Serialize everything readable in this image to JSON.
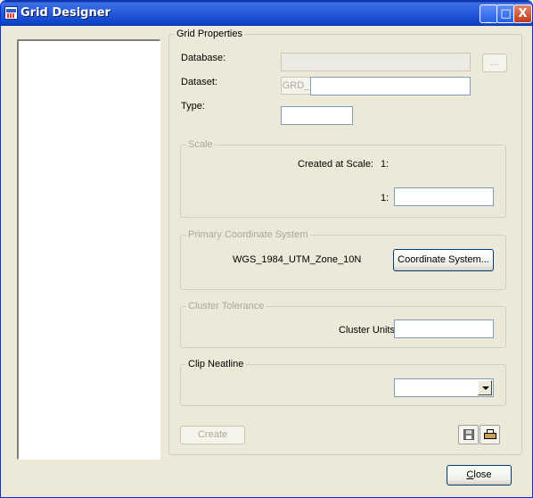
{
  "window": {
    "title": "Grid Designer",
    "minimize_glyph": "_",
    "maximize_glyph": "□",
    "close_glyph": "X"
  },
  "grid_properties": {
    "legend": "Grid Properties",
    "database_label": "Database:",
    "database_value": "",
    "browse_button": "...",
    "dataset_label": "Dataset:",
    "dataset_prefix": "GRD_",
    "dataset_value": "",
    "type_label": "Type:",
    "type_value": ""
  },
  "scale": {
    "legend": "Scale",
    "created_at_scale_label": "Created at Scale:",
    "created_at_scale_value": "1:",
    "scale_prefix": "1:",
    "scale_value": ""
  },
  "coordinate_system": {
    "legend": "Primary Coordinate System",
    "name": "WGS_1984_UTM_Zone_10N",
    "button": "Coordinate System..."
  },
  "cluster_tolerance": {
    "legend": "Cluster Tolerance",
    "units_label": "Cluster Units",
    "value": ""
  },
  "clip_neatline": {
    "legend": "Clip Neatline",
    "selected": ""
  },
  "actions": {
    "create_button": "Create",
    "close_button_prefix": "",
    "close_button_mnemonic": "C",
    "close_button_rest": "lose"
  },
  "icons": [
    "save-icon",
    "print-icon"
  ],
  "colors": {
    "titlebar": "#2a5ddd",
    "dialog_bg": "#ece9d8",
    "disabled_text": "#aca899",
    "close_button": "#c13b1a"
  }
}
